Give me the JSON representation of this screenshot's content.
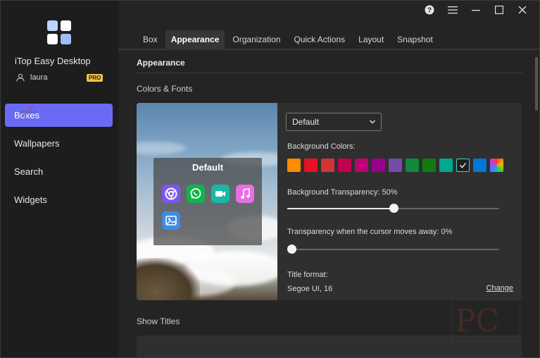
{
  "app": {
    "name": "iTop Easy Desktop",
    "user": "laura",
    "badge": "PRO"
  },
  "sidebar": {
    "items": [
      {
        "label": "Boxes",
        "active": true
      },
      {
        "label": "Wallpapers"
      },
      {
        "label": "Search"
      },
      {
        "label": "Widgets"
      }
    ]
  },
  "tabs": [
    {
      "label": "Box"
    },
    {
      "label": "Appearance",
      "active": true
    },
    {
      "label": "Organization"
    },
    {
      "label": "Quick Actions"
    },
    {
      "label": "Layout"
    },
    {
      "label": "Snapshot"
    }
  ],
  "content": {
    "section_title": "Appearance",
    "colors_fonts_label": "Colors & Fonts",
    "preview_box_title": "Default",
    "dropdown_value": "Default",
    "background_colors_label": "Background Colors:",
    "swatch_colors": [
      "#ff8a00",
      "#e81123",
      "#d13438",
      "#c30052",
      "#bf0077",
      "#9a0089",
      "#744da9",
      "#10893e",
      "#107c10",
      "#00a88f",
      "selected",
      "#0078d7",
      "multicolor"
    ],
    "transparency_label": "Background Transparency: 50%",
    "transparency_value": 50,
    "cursor_transparency_label": "Transparency when the cursor moves away: 0%",
    "cursor_transparency_value": 0,
    "title_format_label": "Title format:",
    "title_format_value": "Segoe UI, 16",
    "change_link": "Change",
    "show_titles_label": "Show Titles"
  },
  "watermark": {
    "pc_logo": "PC"
  },
  "colors": {
    "accent": "#6a6af5",
    "badge": "#f2c14b",
    "selected_border": "#4bd0c7"
  }
}
